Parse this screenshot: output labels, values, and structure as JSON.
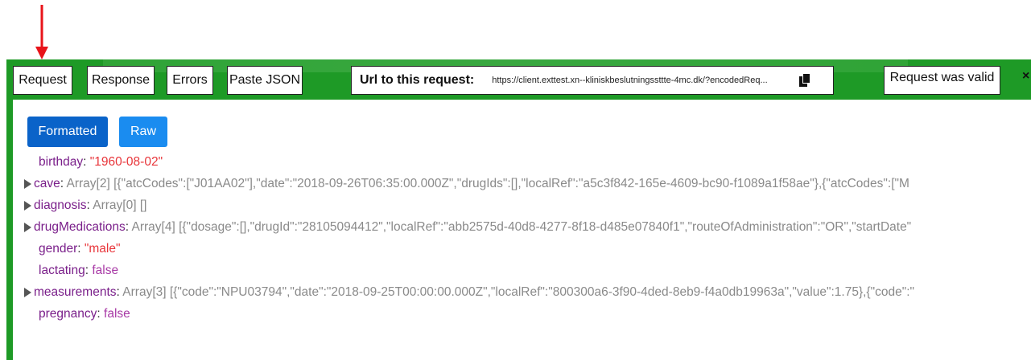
{
  "toolbar": {
    "request_label": "Request",
    "response_label": "Response",
    "errors_label": "Errors",
    "paste_json_label": "Paste JSON",
    "url_label": "Url to this request:",
    "url_value": "https://client.exttest.xn--kliniskbeslutningssttte-4mc.dk/?encodedReq...",
    "status_label": "Request was valid",
    "close_label": "×"
  },
  "view": {
    "formatted_label": "Formatted",
    "raw_label": "Raw"
  },
  "tree": {
    "birthday": {
      "key": "birthday",
      "value": "\"1960-08-02\""
    },
    "cave": {
      "key": "cave",
      "type": "Array[2]",
      "preview": "[{\"atcCodes\":[\"J01AA02\"],\"date\":\"2018-09-26T06:35:00.000Z\",\"drugIds\":[],\"localRef\":\"a5c3f842-165e-4609-bc90-f1089a1f58ae\"},{\"atcCodes\":[\"M"
    },
    "diagnosis": {
      "key": "diagnosis",
      "type": "Array[0]",
      "preview": "[]"
    },
    "drugMedications": {
      "key": "drugMedications",
      "type": "Array[4]",
      "preview": "[{\"dosage\":[],\"drugId\":\"28105094412\",\"localRef\":\"abb2575d-40d8-4277-8f18-d485e07840f1\",\"routeOfAdministration\":\"OR\",\"startDate\""
    },
    "gender": {
      "key": "gender",
      "value": "\"male\""
    },
    "lactating": {
      "key": "lactating",
      "value": "false"
    },
    "measurements": {
      "key": "measurements",
      "type": "Array[3]",
      "preview": "[{\"code\":\"NPU03794\",\"date\":\"2018-09-25T00:00:00.000Z\",\"localRef\":\"800300a6-3f90-4ded-8eb9-f4a0db19963a\",\"value\":1.75},{\"code\":\""
    },
    "pregnancy": {
      "key": "pregnancy",
      "value": "false"
    }
  },
  "colors": {
    "panel_green": "#1e9a26",
    "formatted_blue": "#0a63c9",
    "raw_blue": "#1a8cf0",
    "arrow_red": "#e8141a",
    "key_purple": "#7a1f8a",
    "string_red": "#e8353a"
  }
}
